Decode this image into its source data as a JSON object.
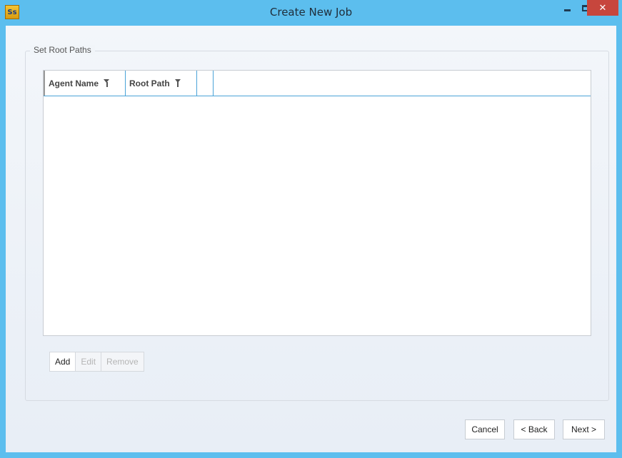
{
  "window": {
    "title": "Create New Job",
    "app_icon_text": "Ss",
    "controls": {
      "minimize_icon": "minimize-icon",
      "maximize_icon": "maximize-icon",
      "close_label": "✕"
    }
  },
  "group": {
    "legend": "Set Root Paths"
  },
  "grid": {
    "columns": [
      {
        "label": "Agent Name",
        "filter_icon": "filter-icon"
      },
      {
        "label": "Root Path",
        "filter_icon": "filter-icon"
      },
      {
        "label": ""
      }
    ],
    "rows": []
  },
  "grid_buttons": {
    "add": "Add",
    "edit": "Edit",
    "remove": "Remove"
  },
  "footer": {
    "cancel": "Cancel",
    "back": "< Back",
    "next": "Next >"
  },
  "colors": {
    "titlebar": "#5cbeee",
    "close_button": "#c7463d",
    "grid_accent": "#4aa3d8"
  }
}
